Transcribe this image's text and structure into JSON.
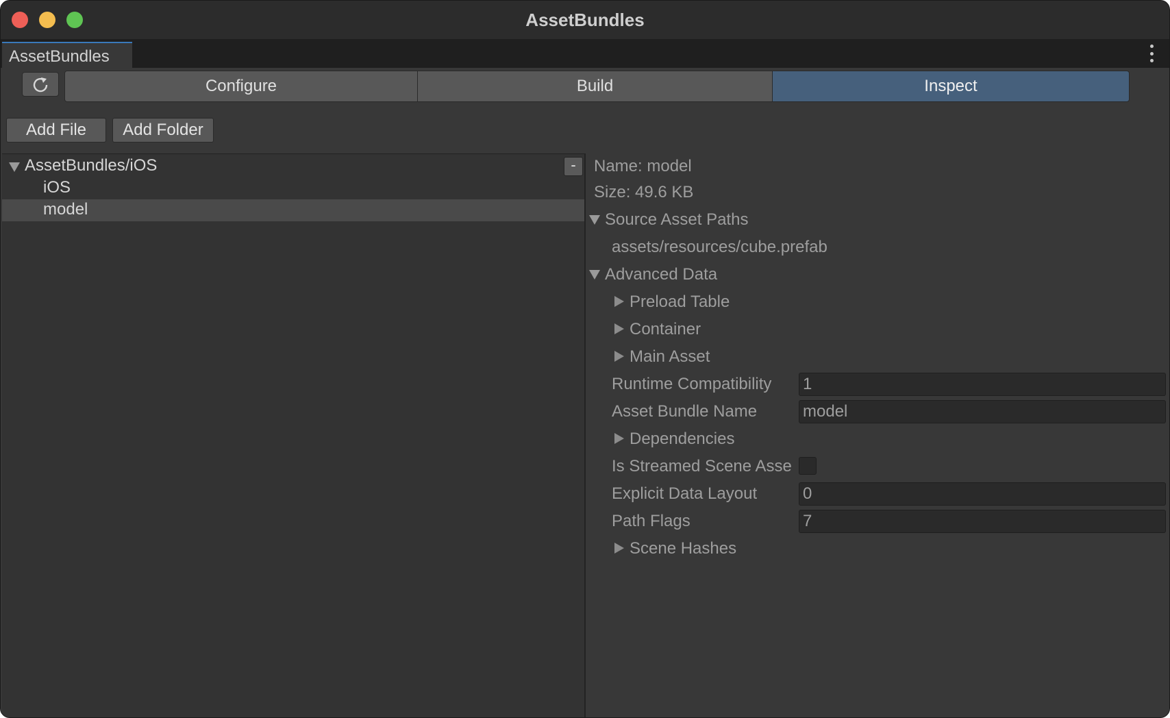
{
  "window": {
    "title": "AssetBundles"
  },
  "tab": {
    "label": "AssetBundles"
  },
  "toolbar": {
    "segments": [
      "Configure",
      "Build",
      "Inspect"
    ],
    "selected": "Inspect"
  },
  "actions": {
    "add_file": "Add File",
    "add_folder": "Add Folder",
    "collapse": "-"
  },
  "tree": {
    "root": "AssetBundles/iOS",
    "items": [
      "iOS",
      "model"
    ],
    "selected": "model"
  },
  "inspector": {
    "name": "Name: model",
    "size": "Size: 49.6 KB",
    "source_asset_paths": {
      "label": "Source Asset Paths",
      "paths": [
        "assets/resources/cube.prefab"
      ]
    },
    "advanced_data": {
      "label": "Advanced Data",
      "preload_table": "Preload Table",
      "container": "Container",
      "main_asset": "Main Asset",
      "runtime_compatibility": {
        "label": "Runtime Compatibility",
        "value": "1"
      },
      "asset_bundle_name": {
        "label": "Asset Bundle Name",
        "value": "model"
      },
      "dependencies": "Dependencies",
      "is_streamed_scene": {
        "label": "Is Streamed Scene Asse",
        "checked": false
      },
      "explicit_data_layout": {
        "label": "Explicit Data Layout",
        "value": "0"
      },
      "path_flags": {
        "label": "Path Flags",
        "value": "7"
      },
      "scene_hashes": "Scene Hashes"
    }
  },
  "colors": {
    "accent_tab": "#3a79bb",
    "selected_segment": "#46607c"
  }
}
